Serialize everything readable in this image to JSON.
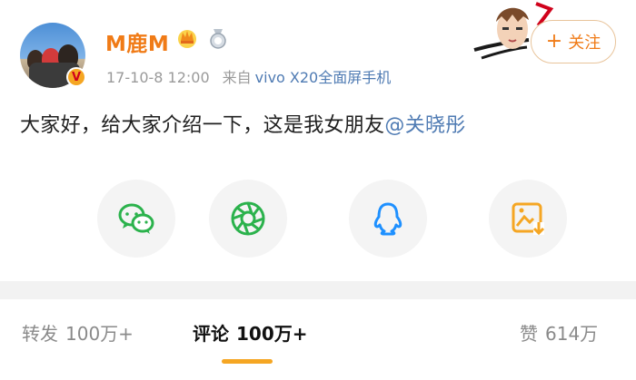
{
  "post": {
    "author": {
      "name": "M鹿M",
      "badges": [
        "crown-icon",
        "medal-icon"
      ],
      "verified_color": "#f5a623"
    },
    "timestamp": "17-10-8 12:00",
    "source_label": "来自",
    "device": "vivo X20全面屏手机",
    "follow_label": "关注",
    "text": "大家好，给大家介绍一下，这是我女朋友",
    "mention": "@关晓彤"
  },
  "share_targets": [
    {
      "icon": "wechat-icon",
      "color": "#2bb24c"
    },
    {
      "icon": "moments-icon",
      "color": "#2bb24c"
    },
    {
      "icon": "qq-icon",
      "color": "#1e90ff"
    },
    {
      "icon": "save-image-icon",
      "color": "#f5a623"
    }
  ],
  "tabs": {
    "repost": {
      "label": "转发",
      "count": "100万+"
    },
    "comments": {
      "label": "评论",
      "count": "100万+"
    },
    "likes": {
      "label": "赞",
      "count": "614万"
    }
  },
  "colors": {
    "username": "#f07b17",
    "link": "#4f7bb3",
    "accent": "#f5a623"
  }
}
